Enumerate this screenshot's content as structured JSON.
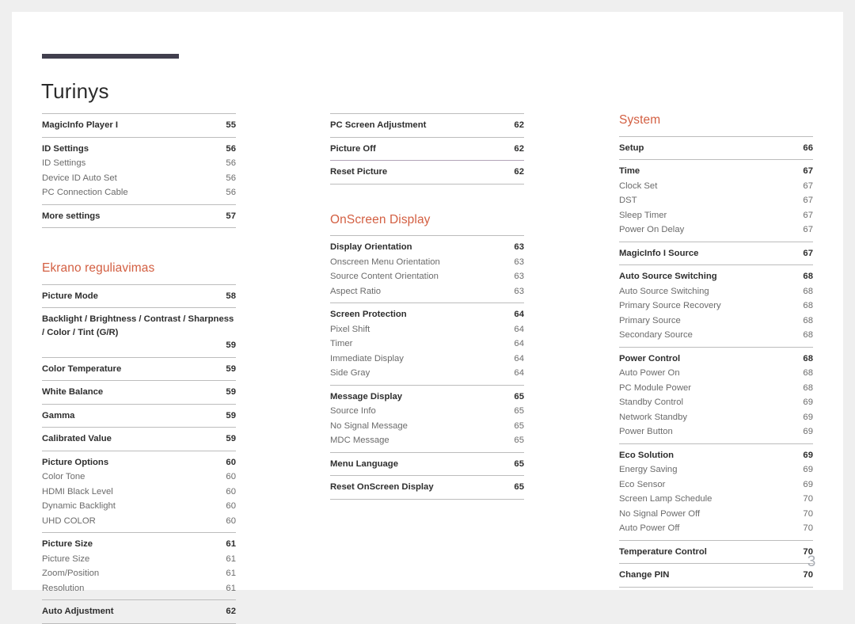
{
  "document": {
    "title": "Turinys",
    "page_number": "3",
    "accent_color": "#d35f42",
    "rule_color": "#413f4e"
  },
  "columns": [
    {
      "name": "column-left",
      "blocks": [
        {
          "type": "group",
          "entries": [
            {
              "label": "MagicInfo Player I",
              "page": "55",
              "level": "major"
            }
          ]
        },
        {
          "type": "group",
          "entries": [
            {
              "label": "ID Settings",
              "page": "56",
              "level": "major"
            },
            {
              "label": "ID Settings",
              "page": "56",
              "level": "minor"
            },
            {
              "label": "Device ID Auto Set",
              "page": "56",
              "level": "minor"
            },
            {
              "label": "PC Connection Cable",
              "page": "56",
              "level": "minor"
            }
          ]
        },
        {
          "type": "group",
          "last": true,
          "entries": [
            {
              "label": "More settings",
              "page": "57",
              "level": "major"
            }
          ]
        },
        {
          "type": "heading",
          "text": "Ekrano reguliavimas"
        },
        {
          "type": "group",
          "entries": [
            {
              "label": "Picture Mode",
              "page": "58",
              "level": "major"
            }
          ]
        },
        {
          "type": "group",
          "entries": [
            {
              "label": "Backlight / Brightness / Contrast / Sharpness / Color / Tint (G/R)",
              "page": "59",
              "level": "major",
              "wrap": true
            }
          ]
        },
        {
          "type": "group",
          "entries": [
            {
              "label": "Color Temperature",
              "page": "59",
              "level": "major"
            }
          ]
        },
        {
          "type": "group",
          "entries": [
            {
              "label": "White Balance",
              "page": "59",
              "level": "major"
            }
          ]
        },
        {
          "type": "group",
          "entries": [
            {
              "label": "Gamma",
              "page": "59",
              "level": "major"
            }
          ]
        },
        {
          "type": "group",
          "entries": [
            {
              "label": "Calibrated Value",
              "page": "59",
              "level": "major"
            }
          ]
        },
        {
          "type": "group",
          "entries": [
            {
              "label": "Picture Options",
              "page": "60",
              "level": "major"
            },
            {
              "label": "Color Tone",
              "page": "60",
              "level": "minor"
            },
            {
              "label": "HDMI Black Level",
              "page": "60",
              "level": "minor"
            },
            {
              "label": "Dynamic Backlight",
              "page": "60",
              "level": "minor"
            },
            {
              "label": "UHD COLOR",
              "page": "60",
              "level": "minor"
            }
          ]
        },
        {
          "type": "group",
          "entries": [
            {
              "label": "Picture Size",
              "page": "61",
              "level": "major"
            },
            {
              "label": "Picture Size",
              "page": "61",
              "level": "minor"
            },
            {
              "label": "Zoom/Position",
              "page": "61",
              "level": "minor"
            },
            {
              "label": "Resolution",
              "page": "61",
              "level": "minor"
            }
          ]
        },
        {
          "type": "group",
          "last": true,
          "entries": [
            {
              "label": "Auto Adjustment",
              "page": "62",
              "level": "major"
            }
          ]
        }
      ]
    },
    {
      "name": "column-middle",
      "blocks": [
        {
          "type": "group",
          "entries": [
            {
              "label": "PC Screen Adjustment",
              "page": "62",
              "level": "major"
            }
          ]
        },
        {
          "type": "group",
          "entries": [
            {
              "label": "Picture Off",
              "page": "62",
              "level": "major"
            }
          ]
        },
        {
          "type": "group",
          "tinted": true,
          "last": true,
          "entries": [
            {
              "label": "Reset Picture",
              "page": "62",
              "level": "major"
            }
          ]
        },
        {
          "type": "heading",
          "text": "OnScreen Display"
        },
        {
          "type": "group",
          "entries": [
            {
              "label": "Display Orientation",
              "page": "63",
              "level": "major"
            },
            {
              "label": "Onscreen Menu Orientation",
              "page": "63",
              "level": "minor"
            },
            {
              "label": "Source Content Orientation",
              "page": "63",
              "level": "minor"
            },
            {
              "label": "Aspect Ratio",
              "page": "63",
              "level": "minor"
            }
          ]
        },
        {
          "type": "group",
          "entries": [
            {
              "label": "Screen Protection",
              "page": "64",
              "level": "major"
            },
            {
              "label": "Pixel Shift",
              "page": "64",
              "level": "minor"
            },
            {
              "label": "Timer",
              "page": "64",
              "level": "minor"
            },
            {
              "label": "Immediate Display",
              "page": "64",
              "level": "minor"
            },
            {
              "label": "Side Gray",
              "page": "64",
              "level": "minor"
            }
          ]
        },
        {
          "type": "group",
          "entries": [
            {
              "label": "Message Display",
              "page": "65",
              "level": "major"
            },
            {
              "label": "Source Info",
              "page": "65",
              "level": "minor"
            },
            {
              "label": "No Signal Message",
              "page": "65",
              "level": "minor"
            },
            {
              "label": "MDC Message",
              "page": "65",
              "level": "minor"
            }
          ]
        },
        {
          "type": "group",
          "entries": [
            {
              "label": "Menu Language",
              "page": "65",
              "level": "major"
            }
          ]
        },
        {
          "type": "group",
          "last": true,
          "entries": [
            {
              "label": "Reset OnScreen Display",
              "page": "65",
              "level": "major"
            }
          ]
        }
      ]
    },
    {
      "name": "column-right",
      "blocks": [
        {
          "type": "heading",
          "text": "System"
        },
        {
          "type": "group",
          "entries": [
            {
              "label": "Setup",
              "page": "66",
              "level": "major"
            }
          ]
        },
        {
          "type": "group",
          "entries": [
            {
              "label": "Time",
              "page": "67",
              "level": "major"
            },
            {
              "label": "Clock Set",
              "page": "67",
              "level": "minor"
            },
            {
              "label": "DST",
              "page": "67",
              "level": "minor"
            },
            {
              "label": "Sleep Timer",
              "page": "67",
              "level": "minor"
            },
            {
              "label": "Power On Delay",
              "page": "67",
              "level": "minor"
            }
          ]
        },
        {
          "type": "group",
          "entries": [
            {
              "label": "MagicInfo I Source",
              "page": "67",
              "level": "major"
            }
          ]
        },
        {
          "type": "group",
          "entries": [
            {
              "label": "Auto Source Switching",
              "page": "68",
              "level": "major"
            },
            {
              "label": "Auto Source Switching",
              "page": "68",
              "level": "minor"
            },
            {
              "label": "Primary Source Recovery",
              "page": "68",
              "level": "minor"
            },
            {
              "label": "Primary Source",
              "page": "68",
              "level": "minor"
            },
            {
              "label": "Secondary Source",
              "page": "68",
              "level": "minor"
            }
          ]
        },
        {
          "type": "group",
          "entries": [
            {
              "label": "Power Control",
              "page": "68",
              "level": "major"
            },
            {
              "label": "Auto Power On",
              "page": "68",
              "level": "minor"
            },
            {
              "label": "PC Module Power",
              "page": "68",
              "level": "minor"
            },
            {
              "label": "Standby Control",
              "page": "69",
              "level": "minor"
            },
            {
              "label": "Network Standby",
              "page": "69",
              "level": "minor"
            },
            {
              "label": "Power Button",
              "page": "69",
              "level": "minor"
            }
          ]
        },
        {
          "type": "group",
          "entries": [
            {
              "label": "Eco Solution",
              "page": "69",
              "level": "major"
            },
            {
              "label": "Energy Saving",
              "page": "69",
              "level": "minor"
            },
            {
              "label": "Eco Sensor",
              "page": "69",
              "level": "minor"
            },
            {
              "label": "Screen Lamp Schedule",
              "page": "70",
              "level": "minor"
            },
            {
              "label": "No Signal Power Off",
              "page": "70",
              "level": "minor"
            },
            {
              "label": "Auto Power Off",
              "page": "70",
              "level": "minor"
            }
          ]
        },
        {
          "type": "group",
          "entries": [
            {
              "label": "Temperature Control",
              "page": "70",
              "level": "major"
            }
          ]
        },
        {
          "type": "group",
          "last": true,
          "entries": [
            {
              "label": "Change PIN",
              "page": "70",
              "level": "major"
            }
          ]
        }
      ]
    }
  ]
}
